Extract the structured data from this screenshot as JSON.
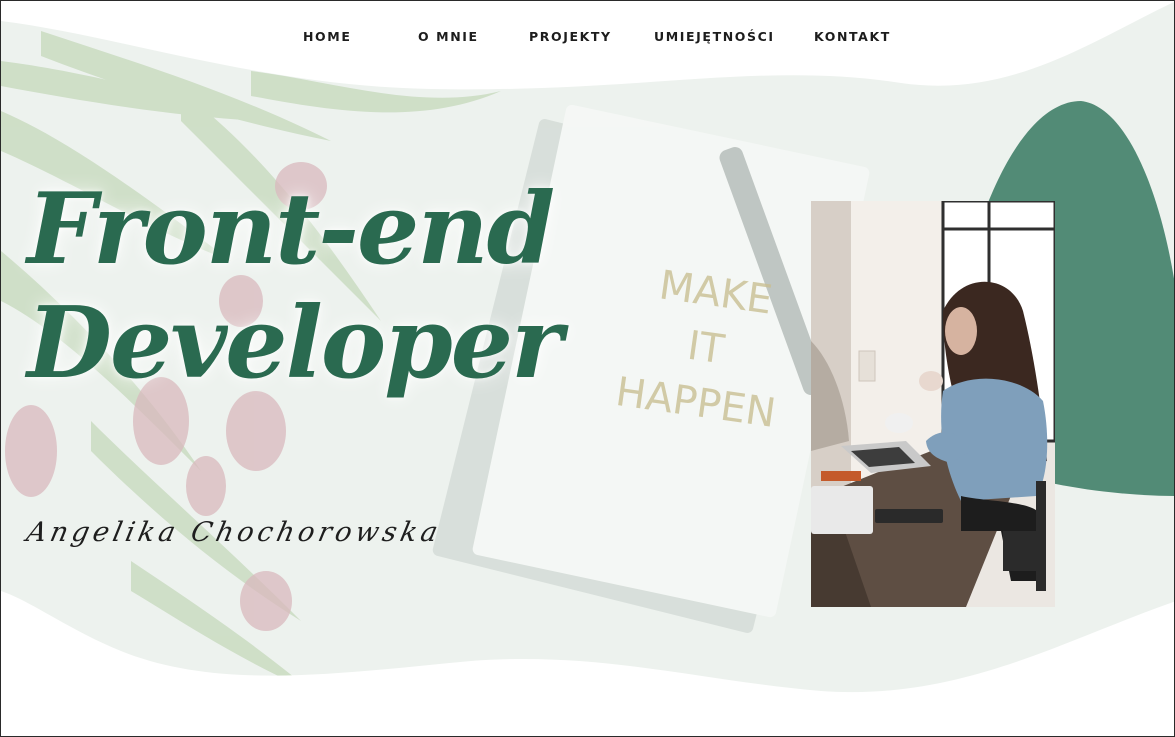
{
  "nav": {
    "items": [
      {
        "label": "HOME"
      },
      {
        "label": "O MNIE"
      },
      {
        "label": "PROJEKTY"
      },
      {
        "label": "UMIEJĘTNOŚCI"
      },
      {
        "label": "KONTAKT"
      }
    ]
  },
  "hero": {
    "title_line1": "Front-end",
    "title_line2": "Developer",
    "signature": "Angelika Chochorowska",
    "notebook_text": [
      "MAKE",
      "IT",
      "HAPPEN"
    ]
  },
  "colors": {
    "accent": "#2a6a50",
    "blob": "#528b76",
    "hero_bg": "#eef3ef"
  }
}
